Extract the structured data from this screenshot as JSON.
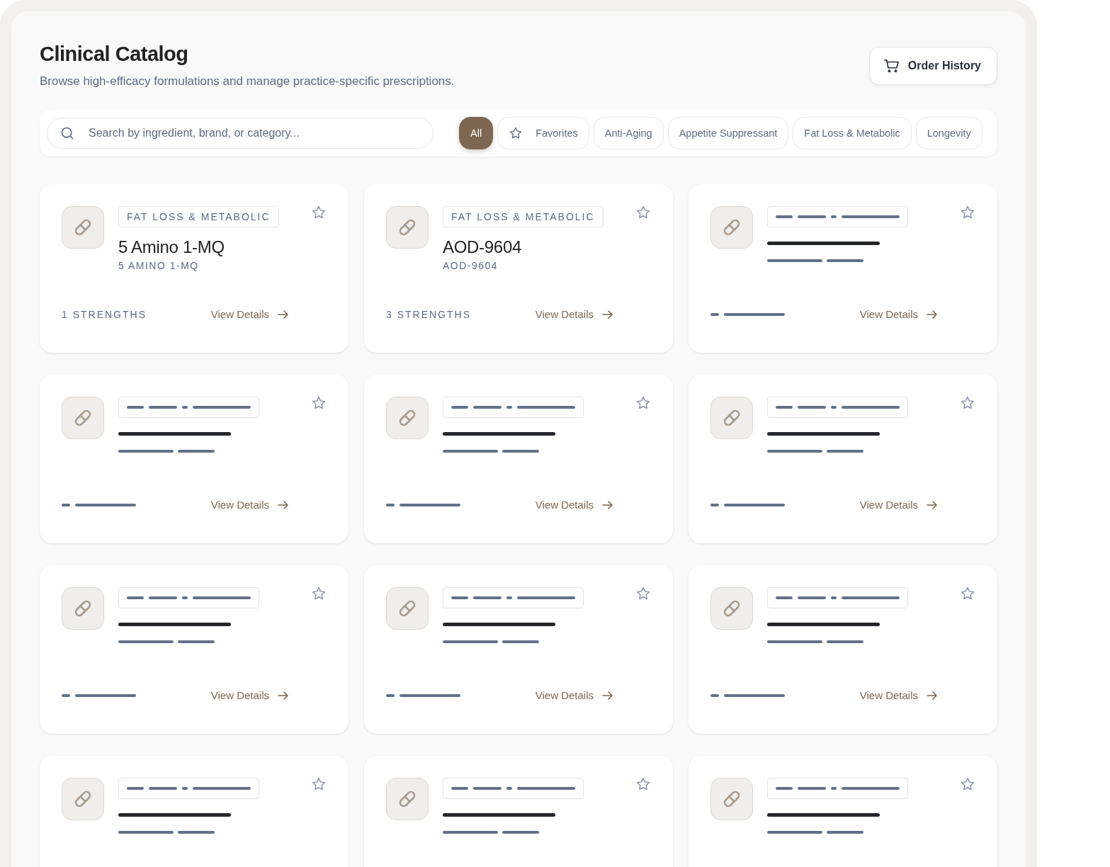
{
  "header": {
    "title": "Clinical Catalog",
    "subtitle": "Browse high-efficacy formulations and manage practice-specific prescriptions.",
    "order_history_button": "Order History"
  },
  "search": {
    "placeholder": "Search by ingredient, brand, or category..."
  },
  "filters": [
    {
      "label": "All",
      "selected": true,
      "kind": "plain"
    },
    {
      "label": "Favorites",
      "selected": false,
      "kind": "favorites"
    },
    {
      "label": "Anti-Aging",
      "selected": false,
      "kind": "plain"
    },
    {
      "label": "Appetite Suppressant",
      "selected": false,
      "kind": "plain"
    },
    {
      "label": "Fat Loss & Metabolic",
      "selected": false,
      "kind": "plain"
    },
    {
      "label": "Longevity",
      "selected": false,
      "kind": "plain"
    }
  ],
  "cards": [
    {
      "kind": "product",
      "category": "FAT LOSS & METABOLIC",
      "name": "5 Amino 1-MQ",
      "subname": "5 AMINO 1-MQ",
      "strengths": "1 STRENGTHS",
      "action": "View Details"
    },
    {
      "kind": "product",
      "category": "FAT LOSS & METABOLIC",
      "name": "AOD-9604",
      "subname": "AOD-9604",
      "strengths": "3 STRENGTHS",
      "action": "View Details"
    },
    {
      "kind": "redacted",
      "action": "View Details"
    },
    {
      "kind": "redacted",
      "action": "View Details"
    },
    {
      "kind": "redacted",
      "action": "View Details"
    },
    {
      "kind": "redacted",
      "action": "View Details"
    },
    {
      "kind": "redacted",
      "action": "View Details"
    },
    {
      "kind": "redacted",
      "action": "View Details"
    },
    {
      "kind": "redacted",
      "action": "View Details"
    },
    {
      "kind": "redacted"
    },
    {
      "kind": "redacted"
    },
    {
      "kind": "redacted"
    }
  ]
}
